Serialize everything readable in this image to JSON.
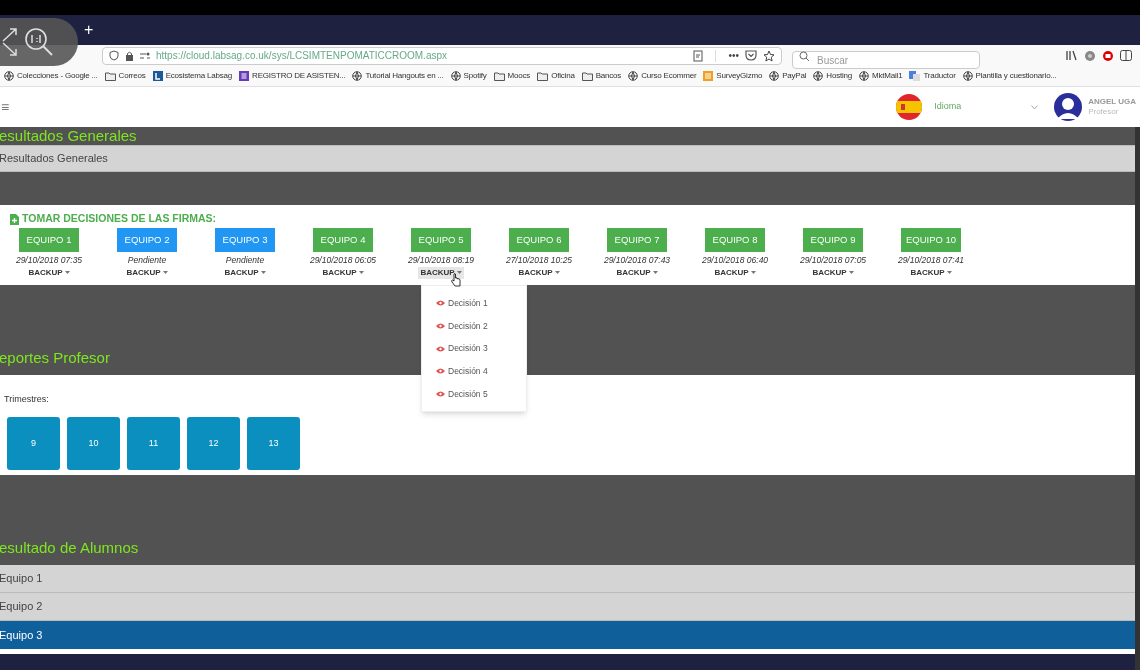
{
  "browser": {
    "new_tab": "+",
    "url": "https://cloud.labsag.co.uk/sys/LCSIMTENPOMATICCROOM.aspx",
    "more": "•••",
    "search": {
      "placeholder": "Buscar"
    },
    "bookmarks": [
      {
        "kind": "globe",
        "label": "Colecciones - Google ..."
      },
      {
        "kind": "folder",
        "label": "Correos"
      },
      {
        "kind": "logo",
        "label": "Ecosistema Labsag"
      },
      {
        "kind": "form",
        "label": "REGISTRO DE ASISTEN..."
      },
      {
        "kind": "globe",
        "label": "Tutorial Hangouts en ..."
      },
      {
        "kind": "globe",
        "label": "Spotify"
      },
      {
        "kind": "folder",
        "label": "Moocs"
      },
      {
        "kind": "folder",
        "label": "Oficina"
      },
      {
        "kind": "folder",
        "label": "Bancos"
      },
      {
        "kind": "globe",
        "label": "Curso Ecommer"
      },
      {
        "kind": "survey",
        "label": "SurveyGizmo"
      },
      {
        "kind": "globe",
        "label": "PayPal"
      },
      {
        "kind": "globe",
        "label": "Hosting"
      },
      {
        "kind": "globe",
        "label": "MktMail1"
      },
      {
        "kind": "translate",
        "label": "Traductor"
      },
      {
        "kind": "globe",
        "label": "Plantilla y cuestionario..."
      }
    ]
  },
  "header": {
    "menu": "≡",
    "language": "Idioma",
    "user_name": "ANGEL UGA",
    "user_role": "Profesor"
  },
  "resultados_generales": {
    "title": "esultados Generales",
    "row": "Resultados Generales"
  },
  "decisiones": {
    "title": "TOMAR DECISIONES DE LAS FIRMAS:",
    "teams": [
      {
        "label": "EQUIPO 1",
        "color": "#4cae4c",
        "date": "29/10/2018 07:35",
        "backup": "BACKUP",
        "expanded": false
      },
      {
        "label": "EQUIPO 2",
        "color": "#2196f3",
        "date": "Pendiente",
        "backup": "BACKUP",
        "expanded": false
      },
      {
        "label": "EQUIPO 3",
        "color": "#2196f3",
        "date": "Pendiente",
        "backup": "BACKUP",
        "expanded": false
      },
      {
        "label": "EQUIPO 4",
        "color": "#4cae4c",
        "date": "29/10/2018 06:05",
        "backup": "BACKUP",
        "expanded": false
      },
      {
        "label": "EQUIPO 5",
        "color": "#4cae4c",
        "date": "29/10/2018 08:19",
        "backup": "BACKUP",
        "expanded": true
      },
      {
        "label": "EQUIPO 6",
        "color": "#4cae4c",
        "date": "27/10/2018 10:25",
        "backup": "BACKUP",
        "expanded": false
      },
      {
        "label": "EQUIPO 7",
        "color": "#4cae4c",
        "date": "29/10/2018 07:43",
        "backup": "BACKUP",
        "expanded": false
      },
      {
        "label": "EQUIPO 8",
        "color": "#4cae4c",
        "date": "29/10/2018 06:40",
        "backup": "BACKUP",
        "expanded": false
      },
      {
        "label": "EQUIPO 9",
        "color": "#4cae4c",
        "date": "29/10/2018 07:05",
        "backup": "BACKUP",
        "expanded": false
      },
      {
        "label": "EQUIPO 10",
        "color": "#4cae4c",
        "date": "29/10/2018 07:41",
        "backup": "BACKUP",
        "expanded": false
      }
    ],
    "backup_menu": [
      "Decisión 1",
      "Decisión 2",
      "Decisión 3",
      "Decisión 4",
      "Decisión 5"
    ]
  },
  "reportes": {
    "title": "eportes Profesor",
    "label": "Trimestres:",
    "quarters": [
      "9",
      "10",
      "11",
      "12",
      "13"
    ]
  },
  "alumnos": {
    "title": "esultado de Alumnos",
    "rows": [
      {
        "label": "Equipo 1",
        "selected": false
      },
      {
        "label": "Equipo 2",
        "selected": false
      },
      {
        "label": "Equipo 3",
        "selected": true
      }
    ]
  }
}
